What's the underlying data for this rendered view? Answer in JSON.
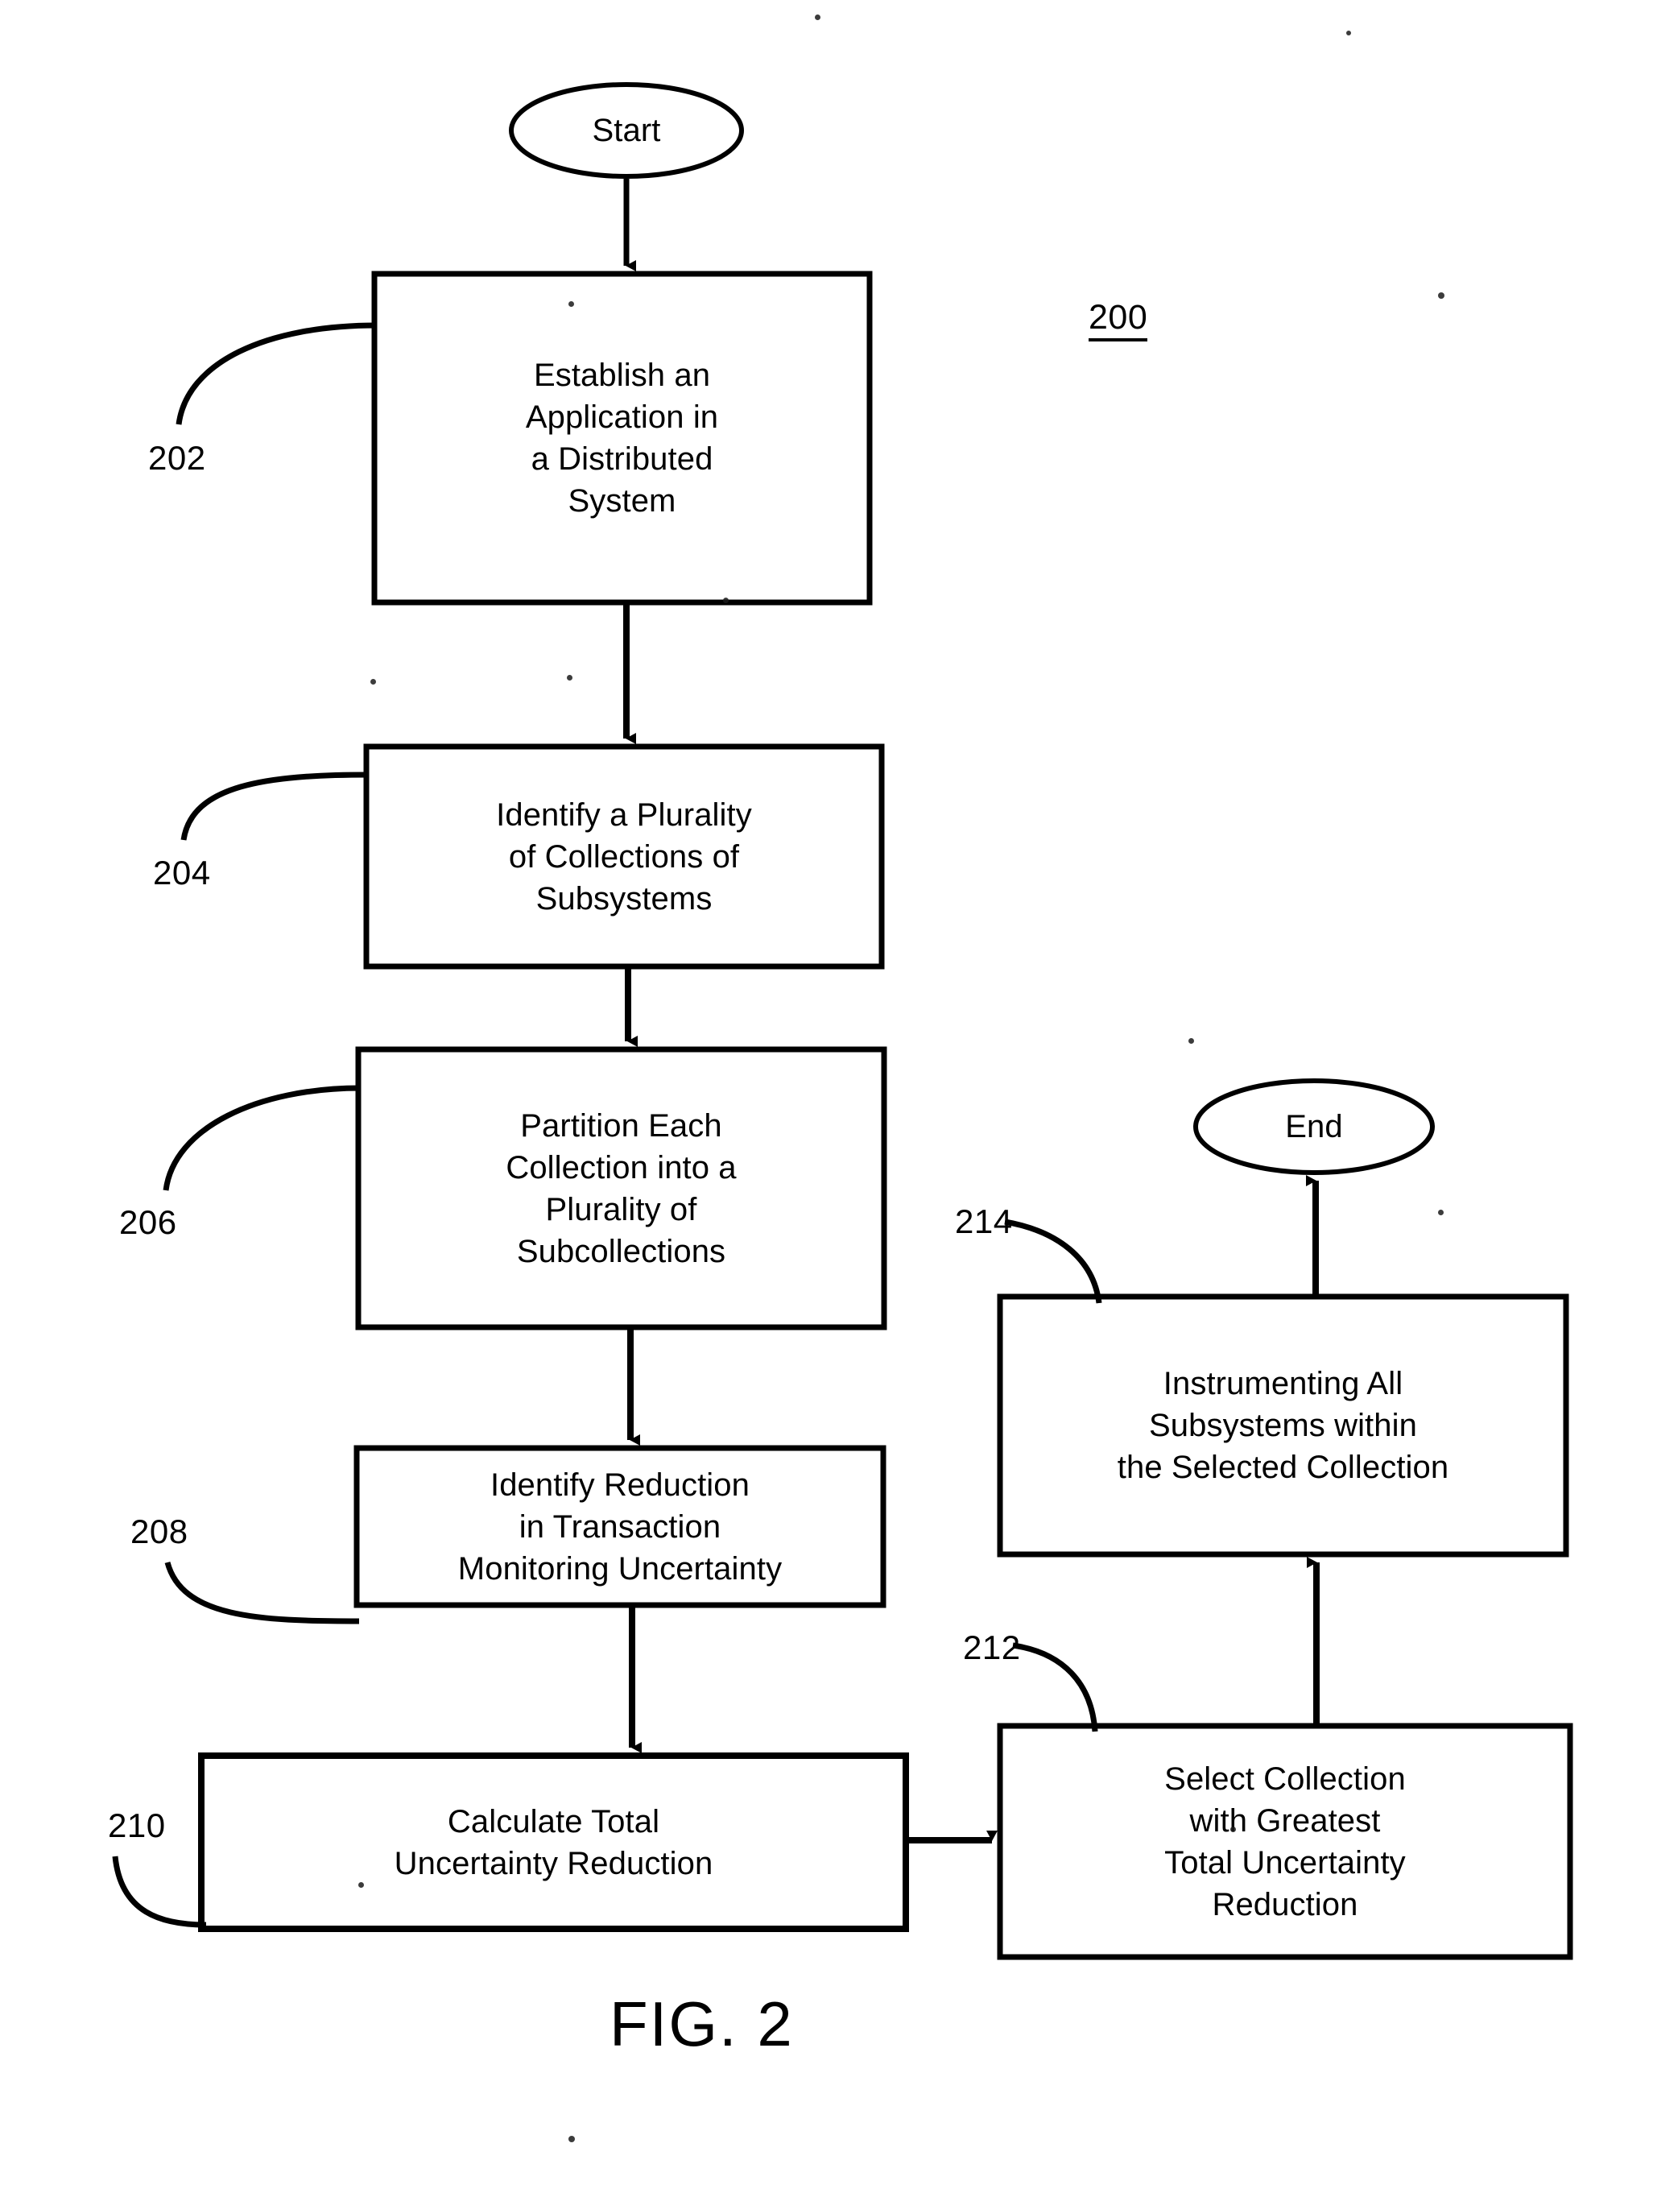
{
  "figure": {
    "caption": "FIG. 2",
    "figure_number": "200"
  },
  "nodes": {
    "start": {
      "label": "Start",
      "shape": "ellipse"
    },
    "end": {
      "label": "End",
      "shape": "ellipse"
    },
    "step_202": {
      "ref": "202",
      "label": "Establish an\nApplication in\na Distributed\nSystem",
      "shape": "rectangle"
    },
    "step_204": {
      "ref": "204",
      "label": "Identify a Plurality\nof Collections of\nSubsystems",
      "shape": "rectangle"
    },
    "step_206": {
      "ref": "206",
      "label": "Partition Each\nCollection into a\nPlurality of\nSubcollections",
      "shape": "rectangle"
    },
    "step_208": {
      "ref": "208",
      "label": "Identify Reduction\nin Transaction\nMonitoring Uncertainty",
      "shape": "rectangle"
    },
    "step_210": {
      "ref": "210",
      "label": "Calculate Total\nUncertainty Reduction",
      "shape": "rectangle"
    },
    "step_212": {
      "ref": "212",
      "label": "Select Collection\nwith Greatest\nTotal Uncertainty\nReduction",
      "shape": "rectangle"
    },
    "step_214": {
      "ref": "214",
      "label": "Instrumenting All\nSubsystems within\nthe Selected Collection",
      "shape": "rectangle"
    }
  },
  "flow": {
    "edges": [
      {
        "from": "start",
        "to": "step_202",
        "direction": "down"
      },
      {
        "from": "step_202",
        "to": "step_204",
        "direction": "down"
      },
      {
        "from": "step_204",
        "to": "step_206",
        "direction": "down"
      },
      {
        "from": "step_206",
        "to": "step_208",
        "direction": "down"
      },
      {
        "from": "step_208",
        "to": "step_210",
        "direction": "down"
      },
      {
        "from": "step_210",
        "to": "step_212",
        "direction": "right"
      },
      {
        "from": "step_212",
        "to": "step_214",
        "direction": "up"
      },
      {
        "from": "step_214",
        "to": "end",
        "direction": "up"
      }
    ]
  },
  "colors": {
    "stroke": "#000000",
    "fill": "#ffffff",
    "text": "#000000"
  }
}
